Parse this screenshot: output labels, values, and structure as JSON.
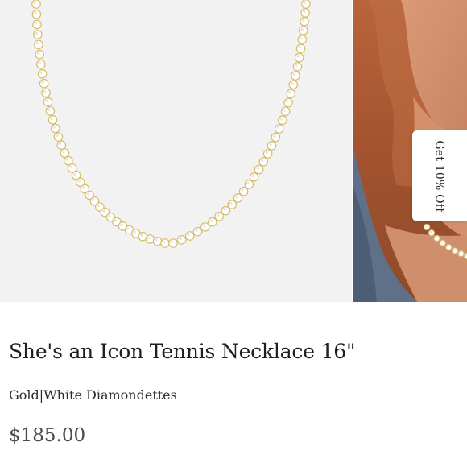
{
  "gallery": {
    "main_image": "necklace-product-photo",
    "secondary_image": "model-wearing-necklace-photo"
  },
  "promo": {
    "label": "Get 10% Off"
  },
  "product": {
    "title": "She's an Icon Tennis Necklace 16\"",
    "variant": "Gold|White Diamondettes",
    "price": "$185.00"
  },
  "colors": {
    "background": "#ffffff",
    "image_background": "#f2f2f2",
    "text_primary": "#1f1f1f",
    "text_price": "#4a4a4a",
    "chain_gold": "#d9bb6a"
  }
}
